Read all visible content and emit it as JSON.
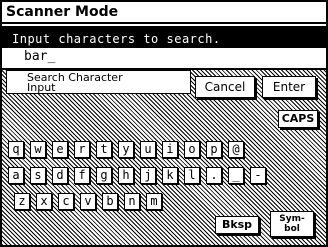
{
  "window": {
    "title": "Scanner Mode"
  },
  "prompt": {
    "message": "Input characters to search.",
    "value": "bar_"
  },
  "search": {
    "label_line1": "Search Character",
    "label_line2": "Input"
  },
  "buttons": {
    "cancel": "Cancel",
    "enter": "Enter",
    "caps": "CAPS",
    "bksp": "Bksp",
    "symbol_line1": "Sym-",
    "symbol_line2": "bol"
  },
  "keyboard": {
    "row1": [
      "q",
      "w",
      "e",
      "r",
      "t",
      "y",
      "u",
      "i",
      "o",
      "p",
      "@"
    ],
    "row2": [
      "a",
      "s",
      "d",
      "f",
      "g",
      "h",
      "j",
      "k",
      "l",
      ".",
      "_",
      "-"
    ],
    "row3": [
      "z",
      "x",
      "c",
      "v",
      "b",
      "n",
      "m"
    ]
  }
}
